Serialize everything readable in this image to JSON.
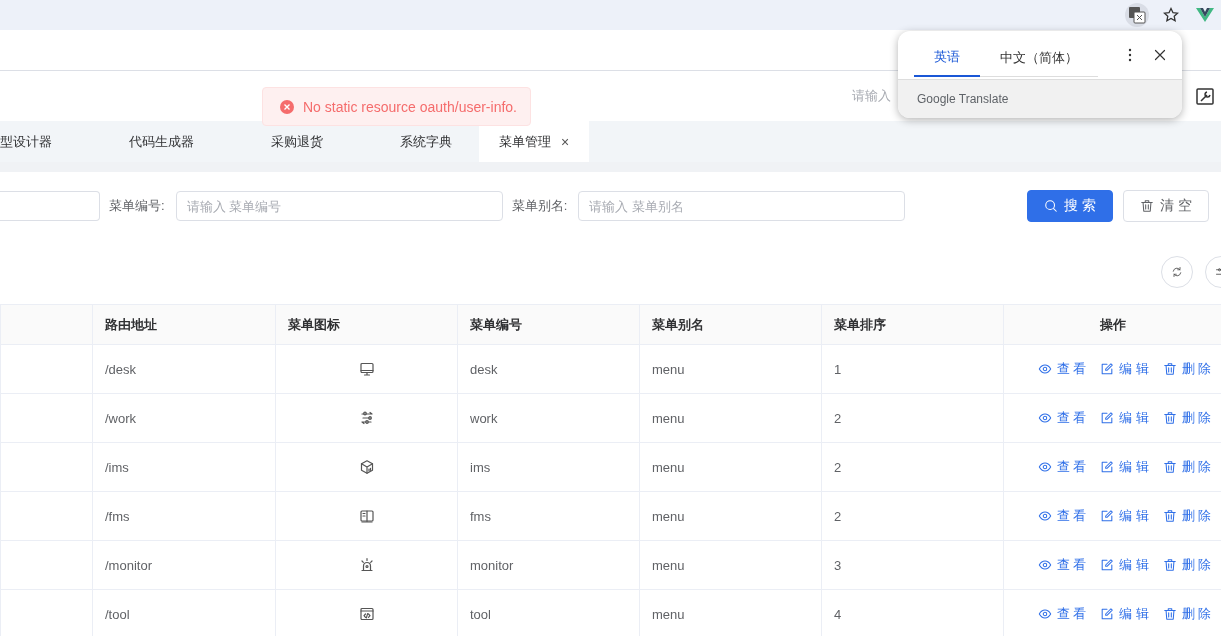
{
  "browser": {
    "translate_popup": {
      "tabs": [
        {
          "label": "英语",
          "selected": true
        },
        {
          "label": "中文（简体）",
          "selected": false
        }
      ],
      "footer": "Google Translate"
    }
  },
  "toast": {
    "message": "No static resource oauth/user-info."
  },
  "header": {
    "search_placeholder": "请输入"
  },
  "tabs": [
    {
      "label": "型设计器",
      "selected": false
    },
    {
      "label": "代码生成器",
      "selected": false
    },
    {
      "label": "采购退货",
      "selected": false
    },
    {
      "label": "系统字典",
      "selected": false
    },
    {
      "label": "菜单管理",
      "selected": true,
      "close": "×"
    }
  ],
  "filters": [
    {
      "label": "菜单编号:",
      "placeholder": "请输入 菜单编号"
    },
    {
      "label": "菜单别名:",
      "placeholder": "请输入 菜单别名"
    }
  ],
  "buttons": [
    {
      "kind": "primary",
      "label": "搜 索"
    },
    {
      "kind": "default",
      "label": "清 空"
    }
  ],
  "table": {
    "columns": [
      "路由地址",
      "菜单图标",
      "菜单编号",
      "菜单别名",
      "菜单排序",
      "操作"
    ],
    "rows": [
      {
        "route": "/desk",
        "code": "desk",
        "alias": "menu",
        "sort": "1",
        "actions": [
          {
            "kind": "view",
            "label": "查 看"
          },
          {
            "kind": "edit",
            "label": "编 辑"
          },
          {
            "kind": "delete",
            "label": "删 除"
          }
        ]
      },
      {
        "route": "/work",
        "code": "work",
        "alias": "menu",
        "sort": "2",
        "actions": [
          {
            "kind": "view",
            "label": "查 看"
          },
          {
            "kind": "edit",
            "label": "编 辑"
          },
          {
            "kind": "delete",
            "label": "删 除"
          }
        ]
      },
      {
        "route": "/ims",
        "code": "ims",
        "alias": "menu",
        "sort": "2",
        "actions": [
          {
            "kind": "view",
            "label": "查 看"
          },
          {
            "kind": "edit",
            "label": "编 辑"
          },
          {
            "kind": "delete",
            "label": "删 除"
          }
        ]
      },
      {
        "route": "/fms",
        "code": "fms",
        "alias": "menu",
        "sort": "2",
        "actions": [
          {
            "kind": "view",
            "label": "查 看"
          },
          {
            "kind": "edit",
            "label": "编 辑"
          },
          {
            "kind": "delete",
            "label": "删 除"
          }
        ]
      },
      {
        "route": "/monitor",
        "code": "monitor",
        "alias": "menu",
        "sort": "3",
        "actions": [
          {
            "kind": "view",
            "label": "查 看"
          },
          {
            "kind": "edit",
            "label": "编 辑"
          },
          {
            "kind": "delete",
            "label": "删 除"
          }
        ]
      },
      {
        "route": "/tool",
        "code": "tool",
        "alias": "menu",
        "sort": "4",
        "actions": [
          {
            "kind": "view",
            "label": "查 看"
          },
          {
            "kind": "edit",
            "label": "编 辑"
          },
          {
            "kind": "delete",
            "label": "删 除"
          }
        ]
      }
    ]
  }
}
